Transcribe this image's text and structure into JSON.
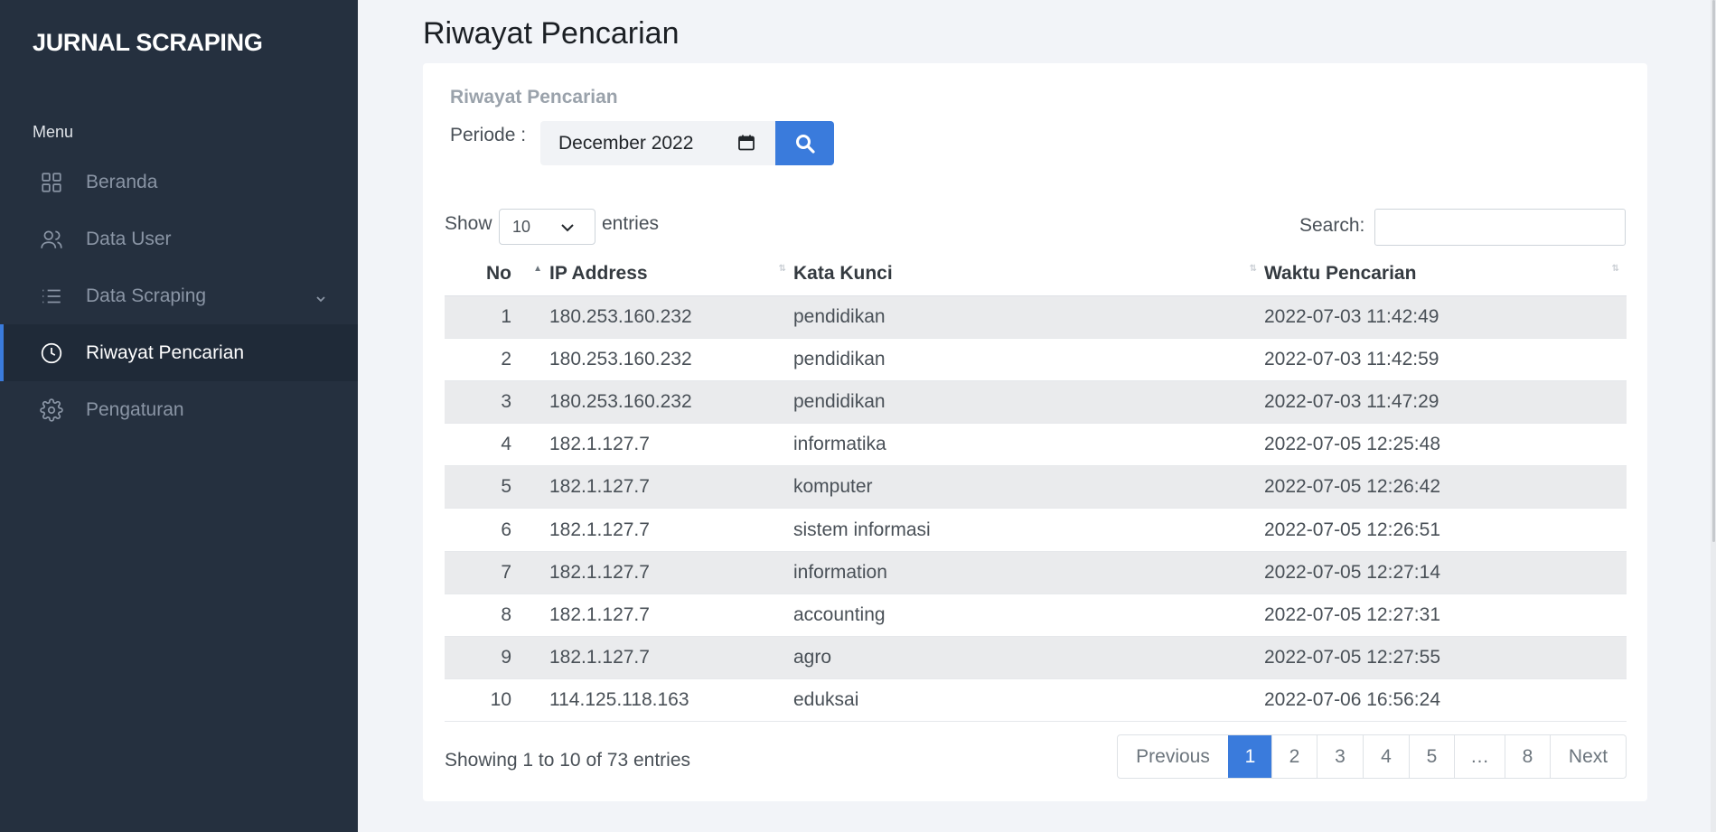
{
  "sidebar": {
    "brand": "JURNAL SCRAPING",
    "menu_title": "Menu",
    "items": [
      {
        "label": "Beranda",
        "icon": "grid-icon",
        "active": false
      },
      {
        "label": "Data User",
        "icon": "users-icon",
        "active": false
      },
      {
        "label": "Data Scraping",
        "icon": "list-icon",
        "active": false,
        "has_submenu": true
      },
      {
        "label": "Riwayat Pencarian",
        "icon": "clock-icon",
        "active": true
      },
      {
        "label": "Pengaturan",
        "icon": "gear-icon",
        "active": false
      }
    ]
  },
  "page": {
    "title": "Riwayat Pencarian"
  },
  "card": {
    "title": "Riwayat Pencarian",
    "periode_label": "Periode :",
    "periode_value": "December 2022"
  },
  "table_controls": {
    "show_label": "Show",
    "length_value": "10",
    "entries_label": "entries",
    "search_label": "Search:",
    "search_value": ""
  },
  "table": {
    "columns": [
      "No",
      "IP Address",
      "Kata Kunci",
      "Waktu Pencarian"
    ],
    "sorted_column": "No",
    "rows": [
      {
        "no": "1",
        "ip": "180.253.160.232",
        "keyword": "pendidikan",
        "time": "2022-07-03 11:42:49"
      },
      {
        "no": "2",
        "ip": "180.253.160.232",
        "keyword": "pendidikan",
        "time": "2022-07-03 11:42:59"
      },
      {
        "no": "3",
        "ip": "180.253.160.232",
        "keyword": "pendidikan",
        "time": "2022-07-03 11:47:29"
      },
      {
        "no": "4",
        "ip": "182.1.127.7",
        "keyword": "informatika",
        "time": "2022-07-05 12:25:48"
      },
      {
        "no": "5",
        "ip": "182.1.127.7",
        "keyword": "komputer",
        "time": "2022-07-05 12:26:42"
      },
      {
        "no": "6",
        "ip": "182.1.127.7",
        "keyword": "sistem informasi",
        "time": "2022-07-05 12:26:51"
      },
      {
        "no": "7",
        "ip": "182.1.127.7",
        "keyword": "information",
        "time": "2022-07-05 12:27:14"
      },
      {
        "no": "8",
        "ip": "182.1.127.7",
        "keyword": "accounting",
        "time": "2022-07-05 12:27:31"
      },
      {
        "no": "9",
        "ip": "182.1.127.7",
        "keyword": "agro",
        "time": "2022-07-05 12:27:55"
      },
      {
        "no": "10",
        "ip": "114.125.118.163",
        "keyword": "eduksai",
        "time": "2022-07-06 16:56:24"
      }
    ]
  },
  "footer": {
    "info": "Showing 1 to 10 of 73 entries",
    "pagination": [
      {
        "label": "Previous",
        "active": false
      },
      {
        "label": "1",
        "active": true
      },
      {
        "label": "2",
        "active": false
      },
      {
        "label": "3",
        "active": false
      },
      {
        "label": "4",
        "active": false
      },
      {
        "label": "5",
        "active": false
      },
      {
        "label": "…",
        "active": false
      },
      {
        "label": "8",
        "active": false
      },
      {
        "label": "Next",
        "active": false
      }
    ]
  },
  "colors": {
    "sidebar_bg": "#25303f",
    "accent": "#3a7bdc",
    "page_bg": "#f2f4f8",
    "stripe": "#eaebed"
  }
}
